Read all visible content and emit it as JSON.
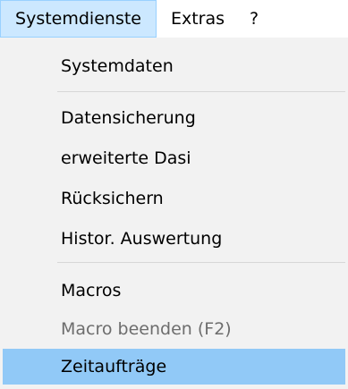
{
  "menubar": {
    "items": [
      {
        "label": "Systemdienste"
      },
      {
        "label": "Extras"
      },
      {
        "label": "?"
      }
    ]
  },
  "dropdown": {
    "items": [
      {
        "label": "Systemdaten"
      },
      {
        "label": "Datensicherung"
      },
      {
        "label": "erweiterte Dasi"
      },
      {
        "label": "Rücksichern"
      },
      {
        "label": "Histor. Auswertung"
      },
      {
        "label": "Macros"
      },
      {
        "label": "Macro beenden (F2)"
      },
      {
        "label": "Zeitaufträge"
      }
    ]
  }
}
